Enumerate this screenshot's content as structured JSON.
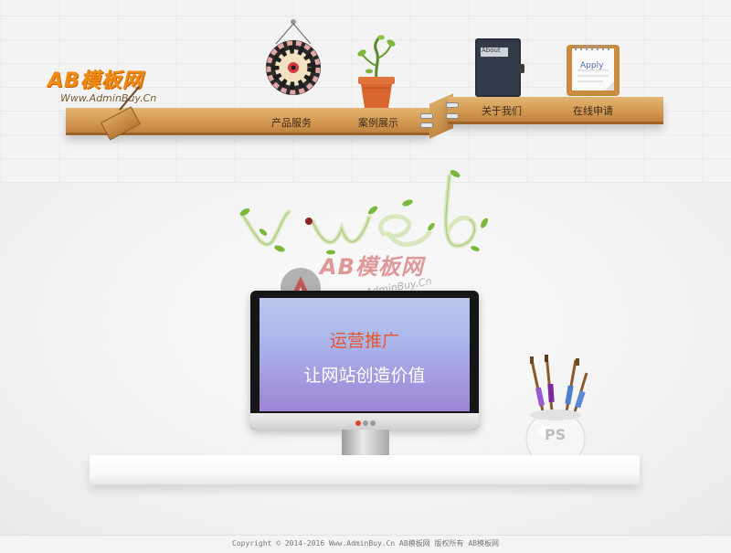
{
  "logo": {
    "brand": "AB模板网",
    "url": "Www.AdminBuy.Cn"
  },
  "nav": {
    "items": [
      {
        "label": "产品服务"
      },
      {
        "label": "案例展示"
      },
      {
        "label": "关于我们"
      },
      {
        "label": "在线申请"
      }
    ]
  },
  "decor": {
    "notebook_label": "About",
    "notepad_label": "Apply"
  },
  "banner": {
    "title": "运营推广",
    "subtitle": "让网站创造价值",
    "brush_pot_label": "PS",
    "watermark_brand": "AB模板网",
    "watermark_url": "Www.AdminBuy.Cn"
  },
  "footer": {
    "text": "Copyright © 2014-2016 Www.AdminBuy.Cn AB模板网 版权所有 AB模板网"
  },
  "colors": {
    "accent_orange": "#f08a12",
    "wood": "#d49a52",
    "screen_title": "#e8542d"
  }
}
